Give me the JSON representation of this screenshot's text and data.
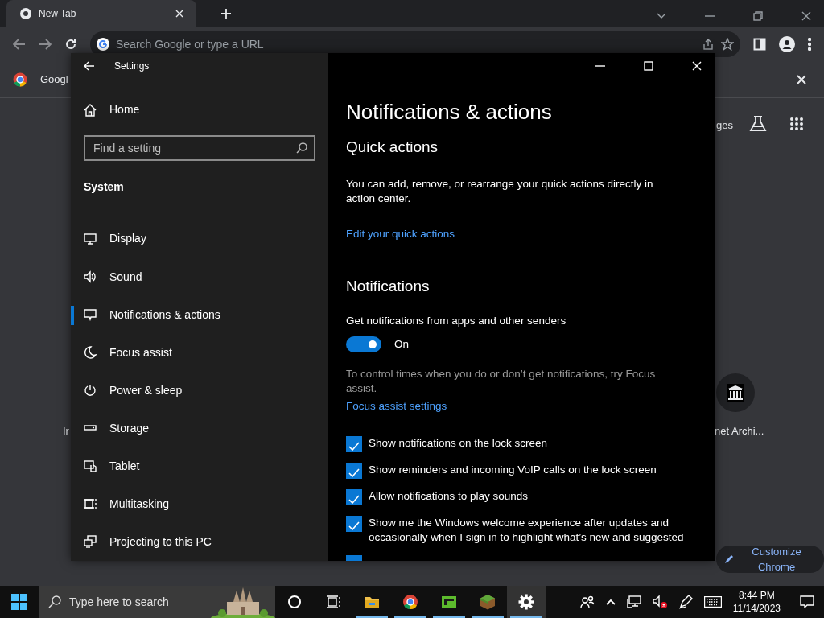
{
  "browser": {
    "tab_title": "New Tab",
    "address_placeholder": "Search Google or type a URL",
    "bookmark": "Googl",
    "page": {
      "header_link": "ges",
      "shortcuts": [
        {
          "label": "Ir"
        },
        {
          "label": "net Archi..."
        }
      ],
      "customize_button": "Customize Chrome"
    }
  },
  "settings": {
    "title": "Settings",
    "home": "Home",
    "search_placeholder": "Find a setting",
    "section": "System",
    "nav": [
      {
        "label": "Display",
        "selected": false
      },
      {
        "label": "Sound",
        "selected": false
      },
      {
        "label": "Notifications & actions",
        "selected": true
      },
      {
        "label": "Focus assist",
        "selected": false
      },
      {
        "label": "Power & sleep",
        "selected": false
      },
      {
        "label": "Storage",
        "selected": false
      },
      {
        "label": "Tablet",
        "selected": false
      },
      {
        "label": "Multitasking",
        "selected": false
      },
      {
        "label": "Projecting to this PC",
        "selected": false
      }
    ],
    "heading": "Notifications & actions",
    "quick_actions": {
      "heading": "Quick actions",
      "text": "You can add, remove, or rearrange your quick actions directly in action center.",
      "link": "Edit your quick actions"
    },
    "notifications": {
      "heading": "Notifications",
      "toggle_caption": "Get notifications from apps and other senders",
      "toggle": {
        "on": true,
        "label": "On"
      },
      "hint": "To control times when you do or don’t get notifications, try Focus assist.",
      "link": "Focus assist settings",
      "checkboxes": [
        {
          "label": "Show notifications on the lock screen",
          "checked": true
        },
        {
          "label": "Show reminders and incoming VoIP calls on the lock screen",
          "checked": true
        },
        {
          "label": "Allow notifications to play sounds",
          "checked": true
        },
        {
          "label": "Show me the Windows welcome experience after updates and occasionally when I sign in to highlight what’s new and suggested",
          "checked": true
        },
        {
          "checked": true
        }
      ]
    }
  },
  "taskbar": {
    "search_placeholder": "Type here to search",
    "apps": [
      {
        "running": false,
        "selected": false
      },
      {
        "running": false,
        "selected": false
      },
      {
        "running": true,
        "selected": false
      },
      {
        "running": true,
        "selected": false
      },
      {
        "running": true,
        "selected": false
      },
      {
        "running": true,
        "selected": false
      },
      {
        "running": true,
        "selected": true
      }
    ],
    "time": "8:44 PM",
    "date": "11/14/2023"
  }
}
